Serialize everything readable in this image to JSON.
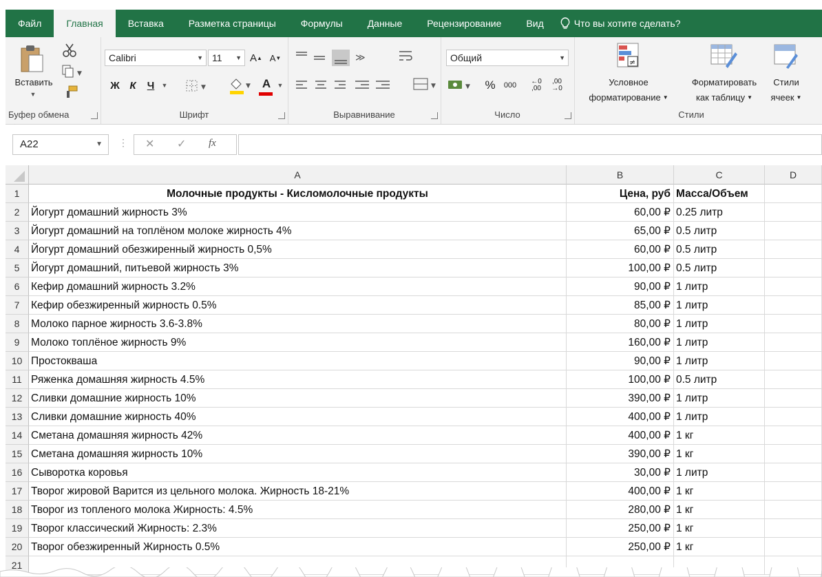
{
  "ribbon_tabs": [
    "Файл",
    "Главная",
    "Вставка",
    "Разметка страницы",
    "Формулы",
    "Данные",
    "Рецензирование",
    "Вид"
  ],
  "active_tab": "Главная",
  "tell_me": "Что вы хотите сделать?",
  "clipboard": {
    "paste_label": "Вставить",
    "group_label": "Буфер обмена"
  },
  "font": {
    "name": "Calibri",
    "size": "11",
    "bold": "Ж",
    "italic": "К",
    "underline": "Ч",
    "grow": "A",
    "shrink": "A",
    "font_color": "A",
    "group_label": "Шрифт"
  },
  "alignment": {
    "group_label": "Выравнивание"
  },
  "number": {
    "format": "Общий",
    "percent": "%",
    "thousands": "000",
    "inc_decimal": ",00",
    "dec_decimal": ",00",
    "group_label": "Число"
  },
  "styles": {
    "conditional_line1": "Условное",
    "conditional_line2": "форматирование",
    "format_table_line1": "Форматировать",
    "format_table_line2": "как таблицу",
    "cell_styles_line1": "Стили",
    "cell_styles_line2": "ячеек",
    "group_label": "Стили"
  },
  "formula_bar": {
    "name_box": "A22",
    "cancel": "✕",
    "enter": "✓",
    "fx": "fx",
    "formula": ""
  },
  "columns": [
    "A",
    "B",
    "C",
    "D"
  ],
  "header_row": {
    "row": "1",
    "a": "Молочные продукты - Кисломолочные продукты",
    "b": "Цена, руб",
    "c": "Масса/Объем"
  },
  "rows": [
    {
      "row": "2",
      "a": "Йогурт домашний жирность 3%",
      "b": "60,00 ₽",
      "c": "0.25 литр"
    },
    {
      "row": "3",
      "a": "Йогурт домашний на топлёном молоке жирность 4%",
      "b": "65,00 ₽",
      "c": "0.5 литр"
    },
    {
      "row": "4",
      "a": "Йогурт домашний обезжиренный жирность 0,5%",
      "b": "60,00 ₽",
      "c": "0.5 литр"
    },
    {
      "row": "5",
      "a": "Йогурт домашний, питьевой жирность 3%",
      "b": "100,00 ₽",
      "c": "0.5 литр"
    },
    {
      "row": "6",
      "a": "Кефир домашний жирность 3.2%",
      "b": "90,00 ₽",
      "c": "1 литр"
    },
    {
      "row": "7",
      "a": "Кефир обезжиренный жирность 0.5%",
      "b": "85,00 ₽",
      "c": "1 литр"
    },
    {
      "row": "8",
      "a": "Молоко парное жирность 3.6-3.8%",
      "b": "80,00 ₽",
      "c": "1 литр"
    },
    {
      "row": "9",
      "a": "Молоко топлёное жирность 9%",
      "b": "160,00 ₽",
      "c": "1 литр"
    },
    {
      "row": "10",
      "a": "Простокваша",
      "b": "90,00 ₽",
      "c": "1 литр"
    },
    {
      "row": "11",
      "a": "Ряженка домашняя жирность 4.5%",
      "b": "100,00 ₽",
      "c": "0.5 литр"
    },
    {
      "row": "12",
      "a": "Сливки домашние жирность 10%",
      "b": "390,00 ₽",
      "c": "1 литр"
    },
    {
      "row": "13",
      "a": "Сливки домашние жирность 40%",
      "b": "400,00 ₽",
      "c": "1 литр"
    },
    {
      "row": "14",
      "a": "Сметана домашняя жирность 42%",
      "b": "400,00 ₽",
      "c": "1 кг"
    },
    {
      "row": "15",
      "a": "Сметана домашняя жирность 10%",
      "b": "390,00 ₽",
      "c": "1 кг"
    },
    {
      "row": "16",
      "a": "Сыворотка коровья",
      "b": "30,00 ₽",
      "c": "1 литр"
    },
    {
      "row": "17",
      "a": "Творог жировой Варится из цельного молока. Жирность 18-21%",
      "b": "400,00 ₽",
      "c": "1 кг"
    },
    {
      "row": "18",
      "a": "Творог из топленого молока Жирность: 4.5%",
      "b": "280,00 ₽",
      "c": "1 кг"
    },
    {
      "row": "19",
      "a": "Творог классический Жирность: 2.3%",
      "b": "250,00 ₽",
      "c": "1 кг"
    },
    {
      "row": "20",
      "a": "Творог обезжиренный Жирность 0.5%",
      "b": "250,00 ₽",
      "c": "1 кг"
    },
    {
      "row": "21",
      "a": "",
      "b": "",
      "c": ""
    }
  ],
  "colors": {
    "excel_green": "#217346",
    "ribbon_bg": "#f3f3f3",
    "header_bg": "#f1f1f1",
    "grid_line": "#d9d9d9"
  },
  "icons": [
    "lightbulb-icon",
    "paste-icon",
    "cut-icon",
    "copy-icon",
    "format-painter-icon",
    "fill-color-icon",
    "font-color-icon",
    "borders-icon",
    "align-icon",
    "wrap-text-icon",
    "merge-icon",
    "currency-icon",
    "conditional-formatting-icon",
    "format-as-table-icon",
    "cell-styles-icon",
    "mouse-pointer-icon"
  ]
}
